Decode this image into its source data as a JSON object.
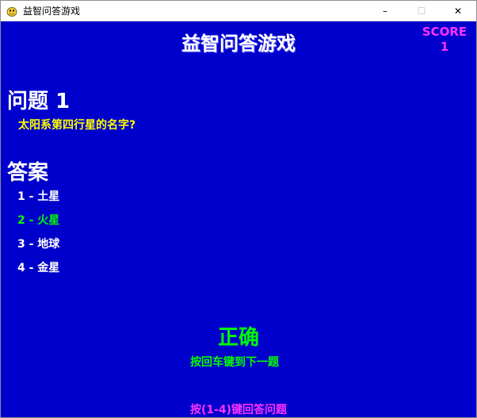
{
  "window": {
    "title": "益智问答游戏",
    "icon": "pygame-snake-icon",
    "controls": {
      "minimize": "–",
      "maximize": "☐",
      "close": "✕"
    }
  },
  "game": {
    "title": "益智问答游戏",
    "score_label": "SCORE",
    "score_value": "1",
    "question_heading": "问题 1",
    "question_text": "太阳系第四行星的名字?",
    "answers_heading": "答案",
    "answers": [
      {
        "label": "1 - 土星",
        "correct": false
      },
      {
        "label": "2 - 火星",
        "correct": true
      },
      {
        "label": "3 - 地球",
        "correct": false
      },
      {
        "label": "4 - 金星",
        "correct": false
      }
    ],
    "result": "正确",
    "next_prompt": "按回车键到下一题",
    "footer_prompt": "按(1-4)键回答问题"
  },
  "colors": {
    "background": "#0000cc",
    "title": "#ffffff",
    "score": "#ff33ff",
    "question": "#ffff00",
    "correct": "#00ff00",
    "footer": "#ff33ff"
  }
}
